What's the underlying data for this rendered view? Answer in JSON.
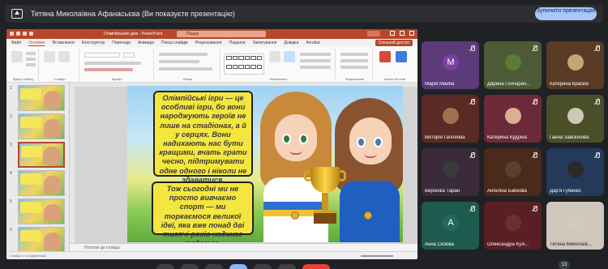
{
  "presenter": {
    "name": "Тетяна Миколаївна Афанасьєва (Ви показуєте презентацію)",
    "stop_label": "Зупинити презентацію"
  },
  "powerpoint": {
    "document_title": "Олімпійський урок - PowerPoint",
    "search_placeholder": "Пошук",
    "tabs": [
      "Файл",
      "Основне",
      "Вставлення",
      "Конструктор",
      "Переходи",
      "Анімація",
      "Показ слайдів",
      "Рецензування",
      "Подання",
      "Запитування",
      "Довідка",
      "Acrobat"
    ],
    "active_tab": "Основне",
    "share_label": "Спільний доступ",
    "ribbon_groups": [
      "Буфер обміну",
      "Слайди",
      "Шрифт",
      "Абзац",
      "Малювання",
      "Редагування",
      "Adobe Acrobat"
    ],
    "slide_numbers": [
      "1",
      "2",
      "3",
      "4",
      "5",
      "6"
    ],
    "notes_placeholder": "Нотатки до слайда",
    "status_text": "Слайд 3 з 12   українська",
    "slide": {
      "text1": "Олімпійські ігри — це особливі ігри, бо вони народжують героїв не лише на стадіонах, а й у серцях. Вони надихають нас бути кращими, вчать грати чесно, підтримувати одне одного і ніколи не здаватися.",
      "text2": "Тож сьогодні ми не просто вивчаємо спорт — ми торкаємося великої ідеї, яка вже понад дві тисячі років надихає людство."
    }
  },
  "participants": [
    {
      "name": "Марія Майба",
      "initial": "M",
      "color": "#7b3fa0",
      "bg": "#5b3b7a"
    },
    {
      "name": "Дарина Гончарен...",
      "initial": "",
      "color": "#5a7a3a",
      "bg": "#4d5a36"
    },
    {
      "name": "Катерина Красюк",
      "initial": "",
      "color": "#c9a27a",
      "bg": "#5a3b24"
    },
    {
      "name": "Вікторія Гапонова",
      "initial": "",
      "color": "#a07050",
      "bg": "#5a2a24"
    },
    {
      "name": "Катерина Кудріна",
      "initial": "",
      "color": "#d8b090",
      "bg": "#6a2a38"
    },
    {
      "name": "Ганна Завізонова",
      "initial": "",
      "color": "#cfc8b8",
      "bg": "#4a4f2a"
    },
    {
      "name": "Вероніка Таран",
      "initial": "",
      "color": "#3a3a3a",
      "bg": "#3a2a3a"
    },
    {
      "name": "Ангеліна Бабкова",
      "initial": "",
      "color": "#5a4030",
      "bg": "#4a2a1a"
    },
    {
      "name": "Дар'я Губенко",
      "initial": "",
      "color": "#2a2a2a",
      "bg": "#243a5a"
    },
    {
      "name": "Анна Сизова",
      "initial": "A",
      "color": "#1e6b5a",
      "bg": "#1f5a4e"
    },
    {
      "name": "Олександра Кузі...",
      "initial": "",
      "color": "#6a3030",
      "bg": "#5a1f24"
    },
    {
      "name": "Тетяна Миколаїв...",
      "initial": "",
      "color": "#d8c8b8",
      "bg": "#cfc6bd"
    }
  ],
  "more_count": "13"
}
